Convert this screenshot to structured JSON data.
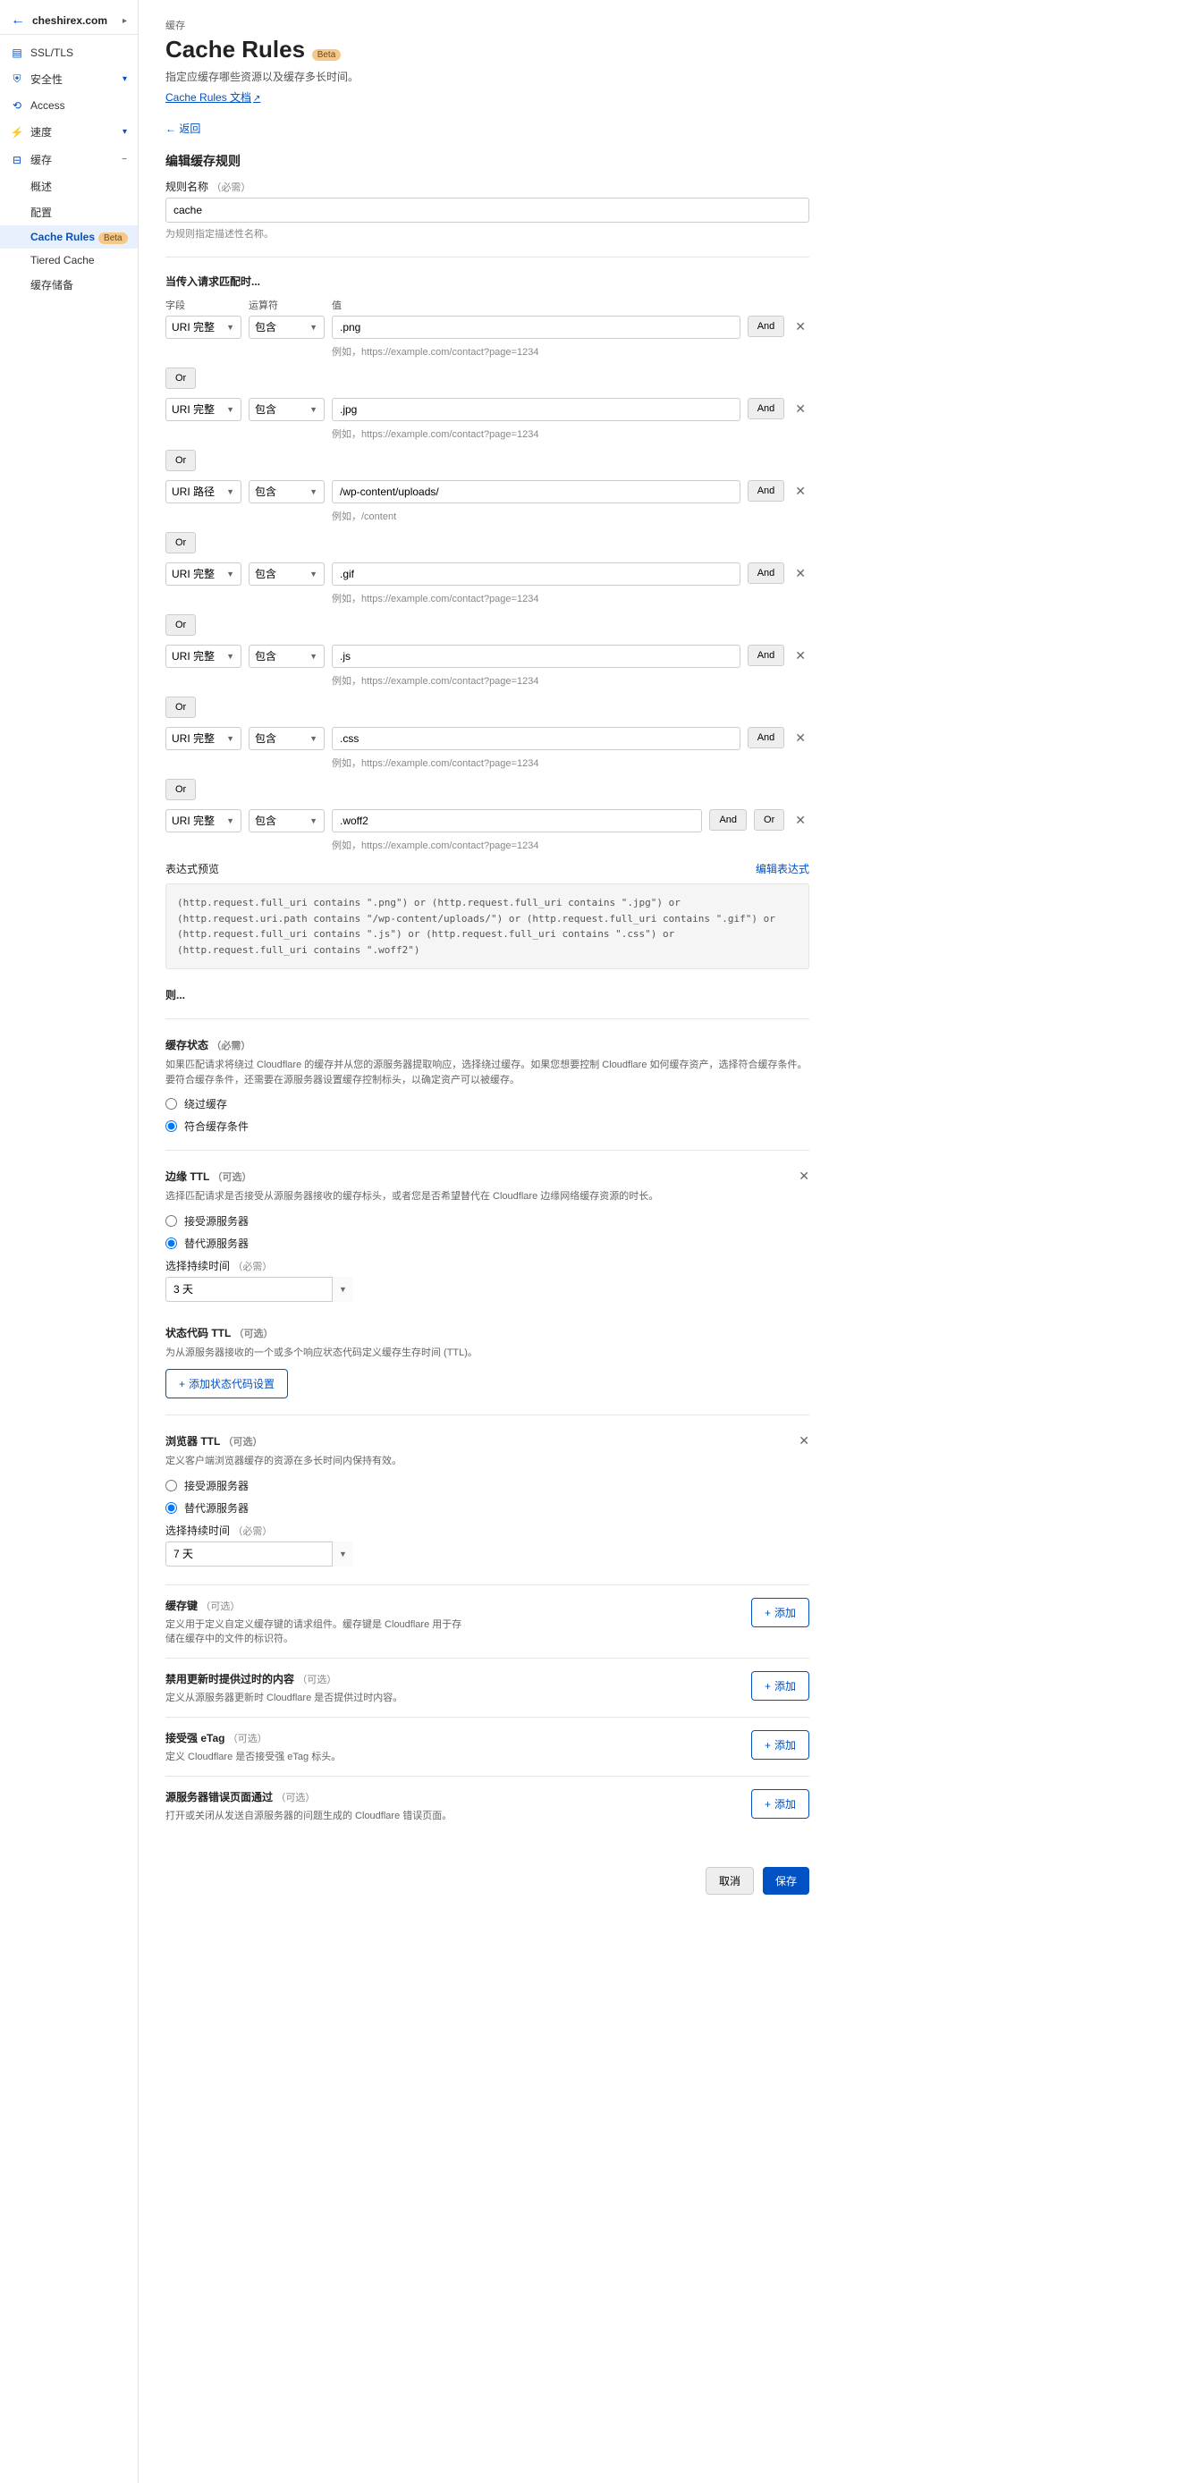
{
  "sidebar": {
    "site": "cheshirex.com",
    "items": [
      {
        "icon": "📊",
        "label": "SSL/TLS"
      },
      {
        "icon": "🛡",
        "label": "安全性"
      },
      {
        "icon": "🔓",
        "label": "Access"
      },
      {
        "icon": "⚡",
        "label": "速度"
      },
      {
        "icon": "💾",
        "label": "缓存"
      }
    ],
    "cache_sub": [
      "概述",
      "配置",
      "Cache Rules",
      "Tiered Cache",
      "缓存储备"
    ],
    "beta": "Beta"
  },
  "page": {
    "breadcrumb": "缓存",
    "title": "Cache Rules",
    "subtitle": "指定应缓存哪些资源以及缓存多长时间。",
    "doc_link": "Cache Rules 文档",
    "return": "返回",
    "edit_title": "编辑缓存规则",
    "name_label": "规则名称",
    "required": "（必需）",
    "name_value": "cache",
    "name_help": "为规则指定描述性名称。",
    "match_title": "当传入请求匹配时...",
    "col_field": "字段",
    "col_op": "运算符",
    "col_val": "值",
    "and": "And",
    "or": "Or",
    "rows": [
      {
        "field": "URI 完整",
        "op": "包含",
        "val": ".png",
        "ex": "例如，https://example.com/contact?page=1234"
      },
      {
        "field": "URI 完整",
        "op": "包含",
        "val": ".jpg",
        "ex": "例如，https://example.com/contact?page=1234"
      },
      {
        "field": "URI 路径",
        "op": "包含",
        "val": "/wp-content/uploads/",
        "ex": "例如，/content"
      },
      {
        "field": "URI 完整",
        "op": "包含",
        "val": ".gif",
        "ex": "例如，https://example.com/contact?page=1234"
      },
      {
        "field": "URI 完整",
        "op": "包含",
        "val": ".js",
        "ex": "例如，https://example.com/contact?page=1234"
      },
      {
        "field": "URI 完整",
        "op": "包含",
        "val": ".css",
        "ex": "例如，https://example.com/contact?page=1234"
      },
      {
        "field": "URI 完整",
        "op": "包含",
        "val": ".woff2",
        "ex": "例如，https://example.com/contact?page=1234"
      }
    ],
    "preview_label": "表达式预览",
    "edit_expr": "编辑表达式",
    "expr": "(http.request.full_uri contains \".png\") or (http.request.full_uri contains \".jpg\") or (http.request.uri.path contains \"/wp-content/uploads/\") or (http.request.full_uri contains \".gif\") or (http.request.full_uri contains \".js\") or (http.request.full_uri contains \".css\") or (http.request.full_uri contains \".woff2\")",
    "then": "则...",
    "cache_status": {
      "title": "缓存状态",
      "req": "（必需）",
      "desc": "如果匹配请求将绕过 Cloudflare 的缓存并从您的源服务器提取响应，选择绕过缓存。如果您想要控制 Cloudflare 如何缓存资产，选择符合缓存条件。要符合缓存条件，还需要在源服务器设置缓存控制标头，以确定资产可以被缓存。",
      "bypass": "绕过缓存",
      "eligible": "符合缓存条件"
    },
    "edge_ttl": {
      "title": "边缘 TTL",
      "opt": "（可选）",
      "desc": "选择匹配请求是否接受从源服务器接收的缓存标头，或者您是否希望替代在 Cloudflare 边缘网络缓存资源的时长。",
      "origin": "接受源服务器",
      "override": "替代源服务器",
      "dur_label": "选择持续时间",
      "dur": "3 天"
    },
    "status_ttl": {
      "title": "状态代码 TTL",
      "opt": "（可选）",
      "desc": "为从源服务器接收的一个或多个响应状态代码定义缓存生存时间 (TTL)。",
      "btn": "添加状态代码设置"
    },
    "browser_ttl": {
      "title": "浏览器 TTL",
      "opt": "（可选）",
      "desc": "定义客户端浏览器缓存的资源在多长时间内保持有效。",
      "origin": "接受源服务器",
      "override": "替代源服务器",
      "dur_label": "选择持续时间",
      "dur": "7 天"
    },
    "extras": [
      {
        "title": "缓存键",
        "opt": "（可选）",
        "desc": "定义用于定义自定义缓存键的请求组件。缓存键是 Cloudflare 用于存储在缓存中的文件的标识符。"
      },
      {
        "title": "禁用更新时提供过时的内容",
        "opt": "（可选）",
        "desc": "定义从源服务器更新时 Cloudflare 是否提供过时内容。"
      },
      {
        "title": "接受强 eTag",
        "opt": "（可选）",
        "desc": "定义 Cloudflare 是否接受强 eTag 标头。"
      },
      {
        "title": "源服务器错误页面通过",
        "opt": "（可选）",
        "desc": "打开或关闭从发送自源服务器的问题生成的 Cloudflare 错误页面。"
      }
    ],
    "add": "添加",
    "cancel": "取消",
    "save": "保存"
  }
}
